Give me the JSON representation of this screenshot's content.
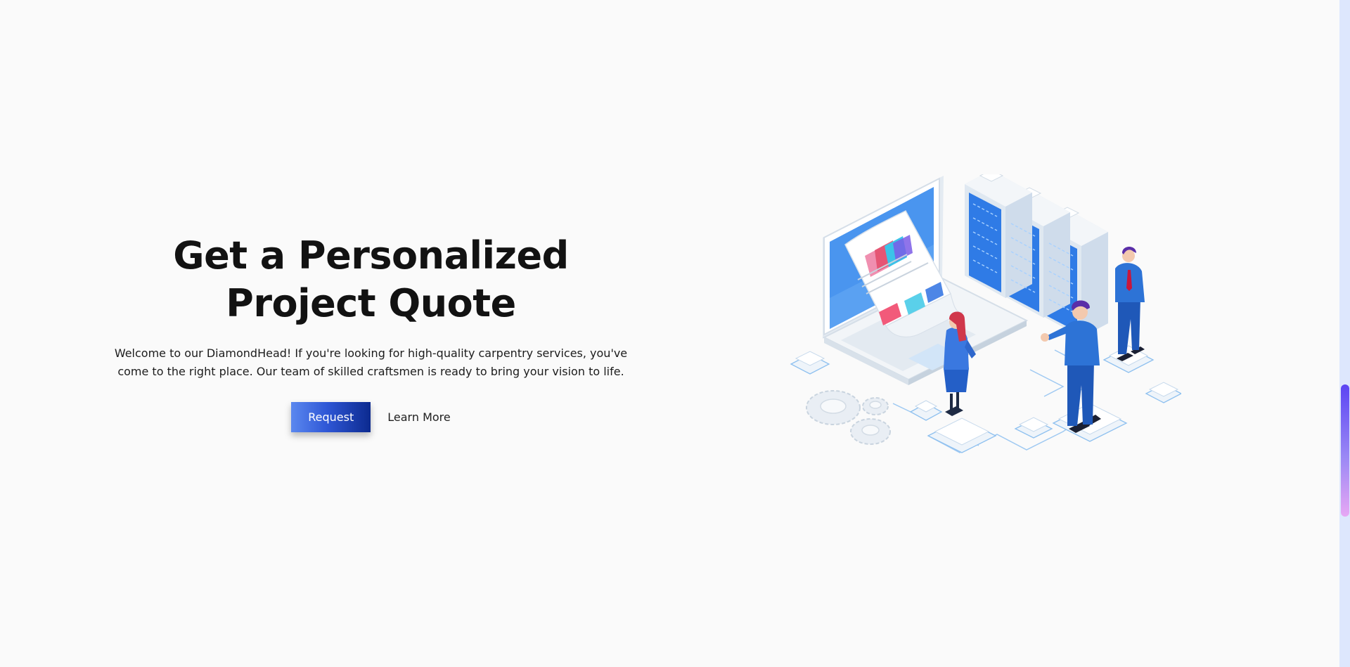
{
  "hero": {
    "title_line1": "Get a Personalized",
    "title_line2": "Project Quote",
    "description_line1": "Welcome to our DiamondHead! If you're looking for high-quality carpentry services, you've",
    "description_line2": "come to the right place. Our team of skilled craftsmen is ready to bring your vision to life.",
    "request_label": "Request",
    "learn_more_label": "Learn More"
  },
  "illustration": {
    "icon": "isometric-data-analytics-illustration"
  },
  "colors": {
    "background": "#fafafa",
    "heading": "#121212",
    "button_gradient_start": "#5b88ef",
    "button_gradient_end": "#0c2a8f",
    "illustration_primary": "#2f7be6",
    "scrollbar_track": "#dde7fd",
    "scrollbar_thumb_top": "#5b45f3",
    "scrollbar_thumb_bottom": "#e7a7f4"
  }
}
